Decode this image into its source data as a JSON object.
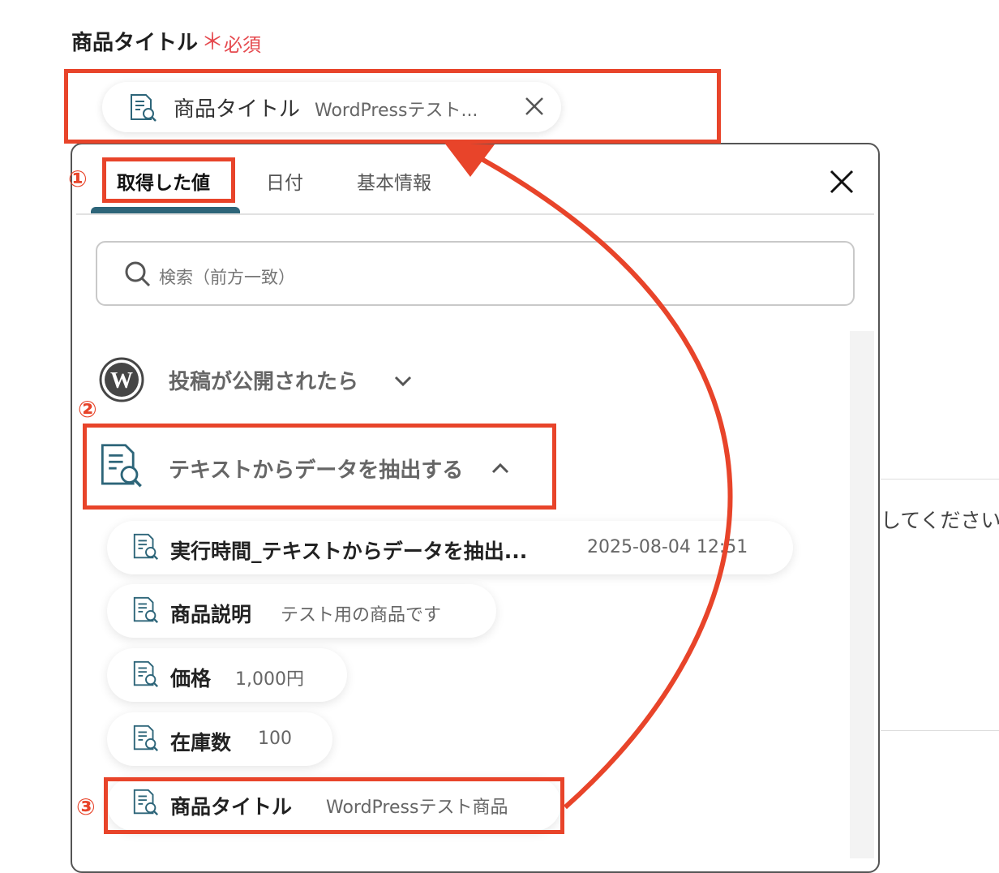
{
  "field": {
    "label": "商品タイトル",
    "required_mark": "＊",
    "required_text": "必須",
    "selected": {
      "label": "商品タイトル",
      "value": "WordPressテスト..."
    }
  },
  "panel": {
    "tabs": [
      {
        "label": "取得した値",
        "active": true
      },
      {
        "label": "日付",
        "active": false
      },
      {
        "label": "基本情報",
        "active": false
      }
    ],
    "search": {
      "placeholder": "検索（前方一致）"
    },
    "sections": [
      {
        "title": "投稿が公開されたら",
        "icon": "wordpress-icon",
        "expanded": false
      },
      {
        "title": "テキストからデータを抽出する",
        "icon": "document-search-icon",
        "expanded": true
      }
    ],
    "items": [
      {
        "label": "実行時間_テキストからデータを抽出...",
        "value": "2025-08-04 12:51"
      },
      {
        "label": "商品説明",
        "value": "テスト用の商品です"
      },
      {
        "label": "価格",
        "value": "1,000円"
      },
      {
        "label": "在庫数",
        "value": "100"
      },
      {
        "label": "商品タイトル",
        "value": "WordPressテスト商品"
      }
    ]
  },
  "annotations": {
    "step1": "①",
    "step2": "②",
    "step3": "③",
    "color": "#e8442a"
  },
  "background": {
    "partial_text": "してください"
  }
}
